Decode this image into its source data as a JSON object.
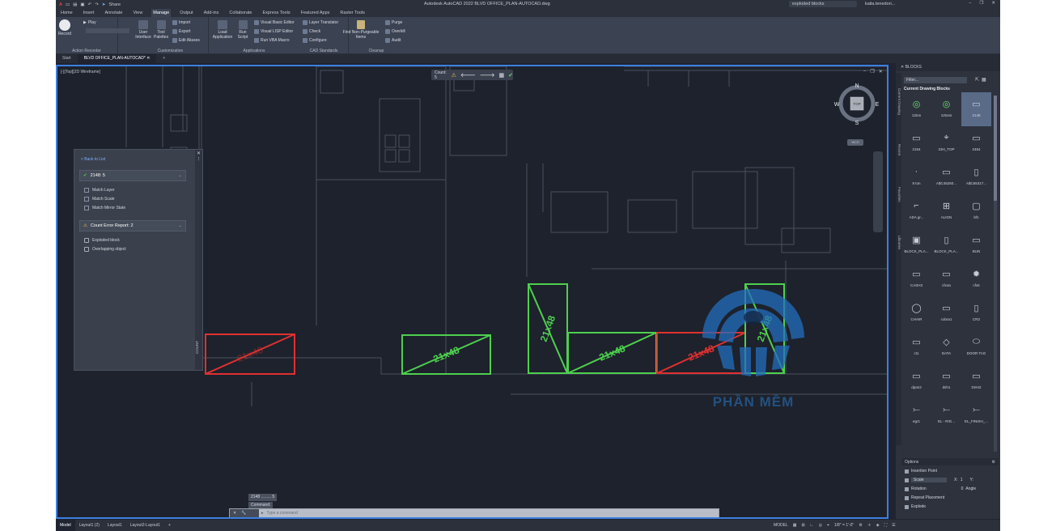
{
  "titlebar": {
    "title": "Autodesk AutoCAD 2022   BLVD OFFICE_PLAN-AUTOCAD.dwg",
    "search_value": "exploded blocks",
    "user": "kaila.tenedori...",
    "share": "Share"
  },
  "ribbon_tabs": [
    "Home",
    "Insert",
    "Annotate",
    "View",
    "Manage",
    "Output",
    "Add-ins",
    "Collaborate",
    "Express Tools",
    "Featured Apps",
    "Raster Tools"
  ],
  "ribbon_active_tab": "Manage",
  "ribbon": {
    "action_recorder": {
      "title": "Action Recorder",
      "record": "Record",
      "play": "Play"
    },
    "customization": {
      "title": "Customization",
      "user_interface": "User Interface",
      "tool_palettes": "Tool Palettes",
      "import": "Import",
      "export": "Export",
      "edit_aliases": "Edit Aliases"
    },
    "applications": {
      "title": "Applications",
      "load_application": "Load Application",
      "run_script": "Run Script",
      "vba": "Visual Basic Editor",
      "vlisp": "Visual LISP Editor",
      "run_vba": "Run VBA Macro"
    },
    "cad_standards": {
      "title": "CAD Standards",
      "layer_translator": "Layer Translator",
      "check": "Check",
      "configure": "Configure"
    },
    "cleanup": {
      "title": "Cleanup",
      "find": "Find Non-Purgeable Items",
      "purge": "Purge",
      "overkill": "Overkill",
      "audit": "Audit"
    }
  },
  "doc_tabs": [
    "Start",
    "BLVD OFFICE_PLAN-AUTOCAD*"
  ],
  "viewport": {
    "label": "[-][Top][2D Wireframe]",
    "count_toolbar": "Count: 5",
    "compass": {
      "n": "N",
      "s": "S",
      "e": "E",
      "w": "W",
      "top": "TOP",
      "wcs": "WCS"
    }
  },
  "count_palette": {
    "back": "< Back to List",
    "block_header": "2148: 5",
    "checks": [
      "Match Layer",
      "Match Scale",
      "Match Mirror State"
    ],
    "error_header": "Count Error Report: 2",
    "errors": [
      "Exploded block",
      "Overlapping object"
    ],
    "side_title": "COUNT"
  },
  "drawing_labels": [
    "21x48",
    "21x48",
    "21x48",
    "21x48",
    "21x48",
    "21x48",
    "21x48"
  ],
  "watermark": "PHẦN MỀM",
  "command": {
    "history": [
      "2148 ......... 5",
      "Command:"
    ],
    "placeholder": "Type a command"
  },
  "blocks_palette": {
    "header": "BLOCKS",
    "filter": "Filter...",
    "section": "Current Drawing Blocks",
    "side_tabs": [
      "Current Drawing",
      "Recent",
      "Favorites",
      "Libraries"
    ],
    "items": [
      "12ton",
      "12tons",
      "2148",
      "2154",
      "23H_TOP",
      "2454",
      "8 ton",
      "A$C45250...",
      "A$C65317...",
      "ADA gr...",
      "ALIGN",
      "bf1",
      "BLOCK_PLA...",
      "BLOCK_PLA...",
      "BUN",
      "CASH3",
      "cfx4a",
      "cfx5",
      "CHAIR",
      "cobra1",
      "CR2",
      "ct1",
      "DATA",
      "DOOR TAG",
      "dpan2",
      "dsh1",
      "DSH2",
      "egr1",
      "EL - RIG...",
      "EL_FINISH_..."
    ],
    "selected": "2148",
    "options": {
      "title": "Options",
      "insertion_point": "Insertion Point",
      "scale": "Scale",
      "rotation": "Rotation",
      "angle": "Angle",
      "repeat_placement": "Repeat Placement",
      "explode": "Explode",
      "x": "X:",
      "y": "Y:",
      "x_val": "1",
      "y_val": "1",
      "angle_val": "0"
    }
  },
  "statusbar": {
    "layouts": [
      "Model",
      "Layout1 (2)",
      "Layout1",
      "Layout2-Layout1"
    ],
    "model": "MODEL",
    "scale": "1/8\" = 1'-0\""
  }
}
